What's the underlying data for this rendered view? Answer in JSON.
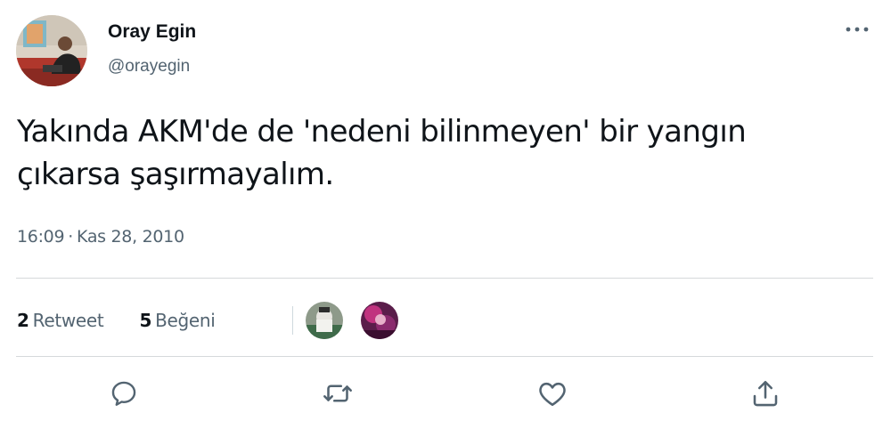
{
  "author": {
    "name": "Oray Egin",
    "handle": "@orayegin",
    "avatar_icon": "profile-photo"
  },
  "tweet": {
    "text_line1": "Yakında AKM'de de 'nedeni bilinmeyen' bir yangın",
    "text_line2": "çıkarsa şaşırmayalım.",
    "time": "16:09",
    "separator": "·",
    "date": "Kas 28, 2010"
  },
  "stats": {
    "retweet_count": "2",
    "retweet_label": "Retweet",
    "like_count": "5",
    "like_label": "Beğeni"
  },
  "likers": [
    {
      "icon": "liker-avatar-1"
    },
    {
      "icon": "liker-avatar-2"
    }
  ],
  "actions": [
    {
      "icon": "reply-icon"
    },
    {
      "icon": "retweet-icon"
    },
    {
      "icon": "like-icon"
    },
    {
      "icon": "share-icon"
    }
  ],
  "colors": {
    "text_primary": "#0f1419",
    "text_secondary": "#536471",
    "divider": "#d6d9db"
  }
}
